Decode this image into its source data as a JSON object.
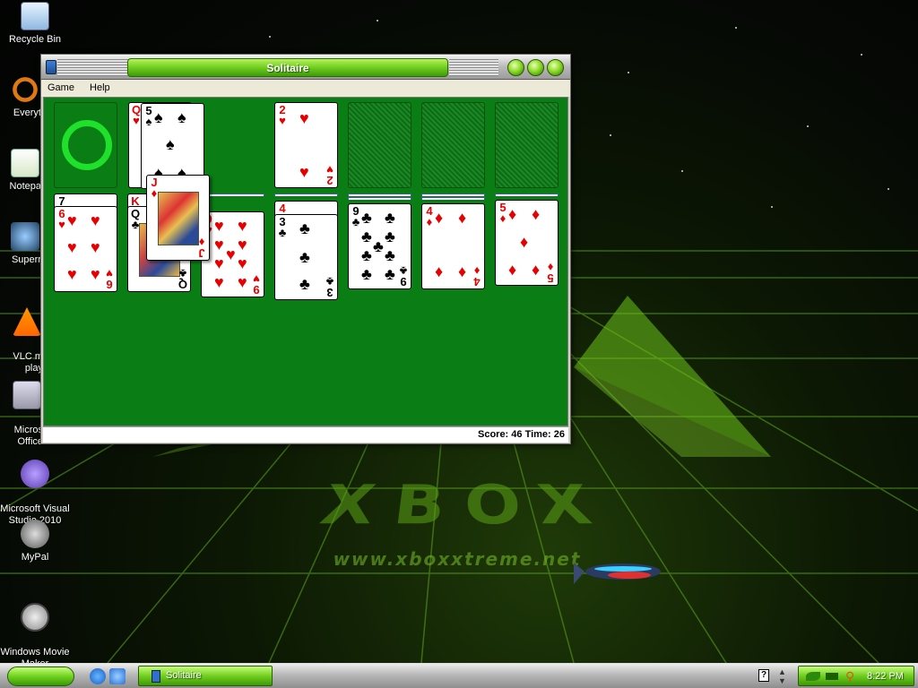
{
  "desktop": {
    "icons": [
      {
        "label": "Recycle Bin"
      },
      {
        "label": "Everyt"
      },
      {
        "label": "Notepa"
      },
      {
        "label": "Superr"
      },
      {
        "label": "VLC m\nplay"
      },
      {
        "label": "Micros\nOffice"
      },
      {
        "label": "Microsoft Visual\nStudio 2010"
      },
      {
        "label": "MyPal"
      },
      {
        "label": "Windows Movie\nMaker"
      }
    ],
    "wallpaper_logo": "XBOX",
    "wallpaper_url": "www.xboxxtreme.net"
  },
  "window": {
    "title": "Solitaire",
    "menu": [
      "Game",
      "Help"
    ],
    "status": "Score: 46 Time: 26",
    "accent_color": "#6fcd1e",
    "felt_color": "#0a7d14"
  },
  "game": {
    "foundations": [
      {
        "rank": "2",
        "suit": "♥",
        "color": "red"
      }
    ],
    "waste_top": {
      "rank": "5",
      "suit": "♠",
      "color": "black"
    },
    "waste_under": {
      "rank": "Q",
      "suit": "♥",
      "color": "red"
    },
    "dragging": {
      "rank": "J",
      "suit": "♦",
      "color": "red"
    },
    "tableau": [
      {
        "covered_top": "7",
        "top": {
          "rank": "6",
          "suit": "♥",
          "color": "red"
        }
      },
      {
        "covered_top": "K",
        "top": {
          "rank": "Q",
          "suit": "♣",
          "color": "black"
        }
      },
      {
        "covered_top": "",
        "top": {
          "rank": "9",
          "suit": "♥",
          "color": "red"
        }
      },
      {
        "covered_top": "4",
        "top": {
          "rank": "3",
          "suit": "♣",
          "color": "black"
        }
      },
      {
        "covered_top": "",
        "top": {
          "rank": "9",
          "suit": "♣",
          "color": "black"
        }
      },
      {
        "covered_top": "",
        "top": {
          "rank": "4",
          "suit": "♦",
          "color": "red"
        }
      },
      {
        "covered_top": "",
        "top": {
          "rank": "5",
          "suit": "♦",
          "color": "red"
        }
      }
    ]
  },
  "taskbar": {
    "task": "Solitaire",
    "clock": "8:22 PM",
    "help_icon": "?"
  }
}
